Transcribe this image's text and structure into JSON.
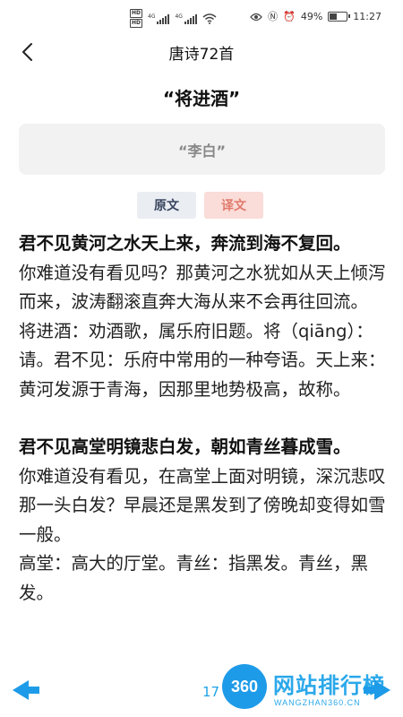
{
  "status_bar": {
    "hd1": "HD",
    "hd2": "HD",
    "net1": "4G",
    "net2": "4G",
    "battery": "49%",
    "time": "11:27"
  },
  "nav": {
    "title": "唐诗72首"
  },
  "poem": {
    "title": "“将进酒”",
    "author": "“李白”"
  },
  "tabs": {
    "original": "原文",
    "translation": "译文"
  },
  "content": {
    "v1": "君不见黄河之水天上来，奔流到海不复回。",
    "t1": "你难道没有看见吗？那黄河之水犹如从天上倾泻而来，波涛翻滚直奔大海从来不会再往回流。",
    "n1": "将进酒：劝酒歌，属乐府旧题。将（qiāng）：请。君不见：乐府中常用的一种夸语。天上来：黄河发源于青海，因那里地势极高，故称。",
    "v2": "君不见高堂明镜悲白发，朝如青丝暮成雪。",
    "t2": "你难道没有看见，在高堂上面对明镜，深沉悲叹那一头白发？早晨还是黑发到了傍晚却变得如雪一般。",
    "n2": "高堂：高大的厅堂。青丝：指黑发。青丝，黑发。"
  },
  "watermark": {
    "page": "17",
    "logo": "360",
    "text": "网站排行榜",
    "sub": "WANGZHAN360.CN"
  },
  "colors": {
    "tab_orig_bg": "#eaedf2",
    "tab_trans_bg": "#fadcd8",
    "watermark_blue": "#1e9be8"
  }
}
